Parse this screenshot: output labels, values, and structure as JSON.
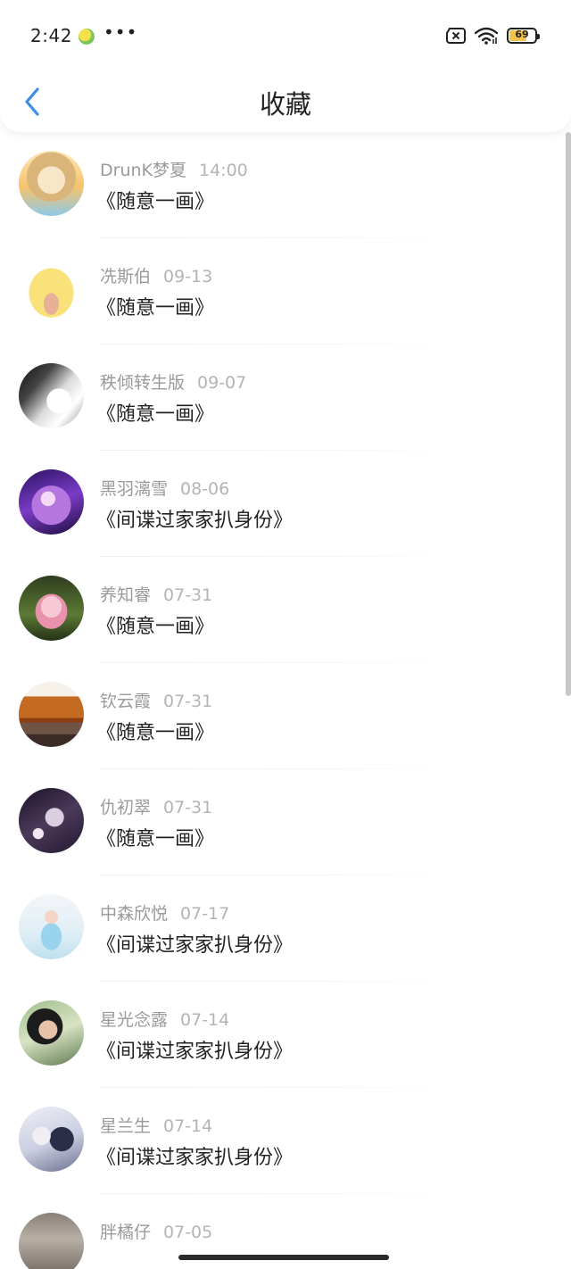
{
  "status_bar": {
    "time": "2:42",
    "dots": "•••",
    "battery_level": "69",
    "battery_percent": 69
  },
  "nav": {
    "title": "收藏"
  },
  "colors": {
    "accent": "#3a8ee6",
    "text_primary": "#222222",
    "text_secondary": "#9a9a9a",
    "battery": "#f3c44b"
  },
  "favorites": [
    {
      "user": "DrunK梦夏",
      "time": "14:00",
      "title": "《随意一画》",
      "avatar": "avatar-anime-girl"
    },
    {
      "user": "冼斯伯",
      "time": "09-13",
      "title": "《随意一画》",
      "avatar": "avatar-pig-cartoon"
    },
    {
      "user": "秩倾转生版",
      "time": "09-07",
      "title": "《随意一画》",
      "avatar": "avatar-sketch"
    },
    {
      "user": "黑羽漓雪",
      "time": "08-06",
      "title": "《间谍过家家扒身份》",
      "avatar": "avatar-purple-anime"
    },
    {
      "user": "养知睿",
      "time": "07-31",
      "title": "《随意一画》",
      "avatar": "avatar-lotus"
    },
    {
      "user": "钦云霞",
      "time": "07-31",
      "title": "《随意一画》",
      "avatar": "avatar-autumn-trees"
    },
    {
      "user": "仇初翠",
      "time": "07-31",
      "title": "《随意一画》",
      "avatar": "avatar-dark-anime"
    },
    {
      "user": "中森欣悦",
      "time": "07-17",
      "title": "《间谍过家家扒身份》",
      "avatar": "avatar-girl-beach"
    },
    {
      "user": "星光念露",
      "time": "07-14",
      "title": "《间谍过家家扒身份》",
      "avatar": "avatar-girl-portrait"
    },
    {
      "user": "星兰生",
      "time": "07-14",
      "title": "《间谍过家家扒身份》",
      "avatar": "avatar-anime-pair"
    },
    {
      "user": "胖橘仔",
      "time": "07-05",
      "title": "",
      "avatar": "avatar-stone"
    }
  ]
}
